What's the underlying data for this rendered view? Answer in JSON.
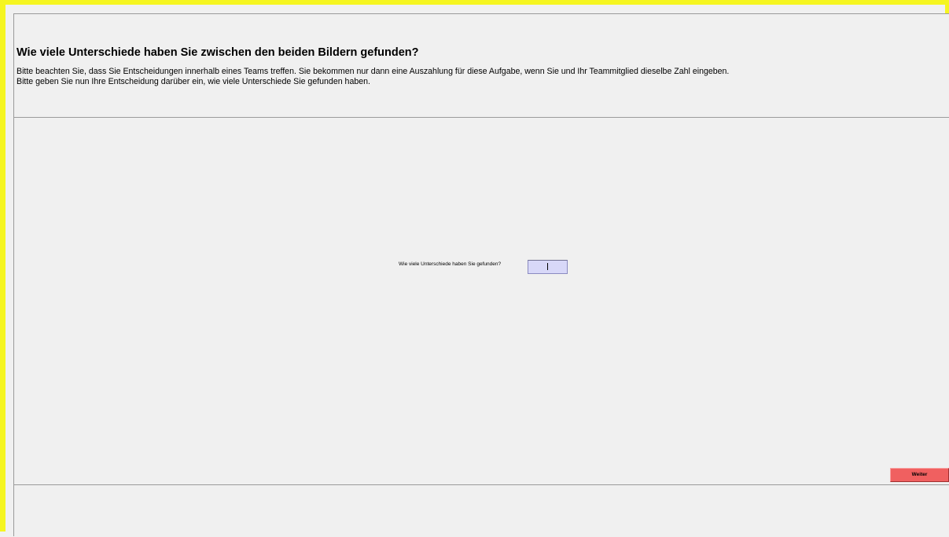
{
  "header": {
    "title": "Wie viele Unterschiede haben Sie zwischen den beiden Bildern gefunden?",
    "description_line1": "Bitte beachten Sie, dass Sie Entscheidungen innerhalb eines Teams treffen. Sie bekommen nur dann eine Auszahlung für diese Aufgabe, wenn Sie und Ihr Teammitglied dieselbe Zahl eingeben.",
    "description_line2": "Bitte geben Sie nun Ihre Entscheidung darüber ein, wie viele Unterschiede Sie gefunden haben."
  },
  "form": {
    "question_label": "Wie viele Unterschiede haben Sie gefunden?",
    "answer_value": ""
  },
  "actions": {
    "continue_label": "Weiter"
  },
  "colors": {
    "frame_border": "#f5f520",
    "background": "#f0f0f0",
    "input_background": "#d8d8f8",
    "button_background": "#f06060"
  }
}
